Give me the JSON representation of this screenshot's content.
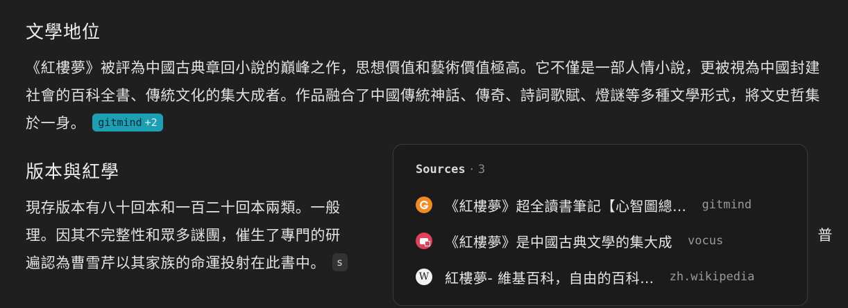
{
  "sections": {
    "literary": {
      "heading": "文學地位",
      "text": "《紅樓夢》被評為中國古典章回小說的巔峰之作，思想價值和藝術價值極高。它不僅是一部人情小說，更被視為中國封建社會的百科全書、傳統文化的集大成者。作品融合了中國傳統神話、傳奇、詩詞歌賦、燈謎等多種文學形式，將文史哲集於一身。",
      "citation_label": "gitmind",
      "citation_more": "+2"
    },
    "versions": {
      "heading": "版本與紅學",
      "line1_start": "現存版本有八十回本和一百二十回本兩類。一般",
      "line2_start": "理。因其不完整性和眾多謎團，催生了專門的研",
      "line2_end": "普",
      "line3": "遍認為曹雪芹以其家族的命運投射在此書中。",
      "citation_partial": "s"
    }
  },
  "sources_popover": {
    "title": "Sources",
    "separator": "·",
    "count": "3",
    "items": [
      {
        "icon": "gitmind-icon",
        "title": "《紅樓夢》超全讀書筆記【心智圖總…",
        "domain": "gitmind"
      },
      {
        "icon": "vocus-icon",
        "title": "《紅樓夢》是中國古典文學的集大成",
        "domain": "vocus"
      },
      {
        "icon": "wikipedia-icon",
        "icon_glyph": "W",
        "title": "紅樓夢- 維基百科，自由的百科…",
        "domain": "zh.wikipedia"
      }
    ]
  }
}
